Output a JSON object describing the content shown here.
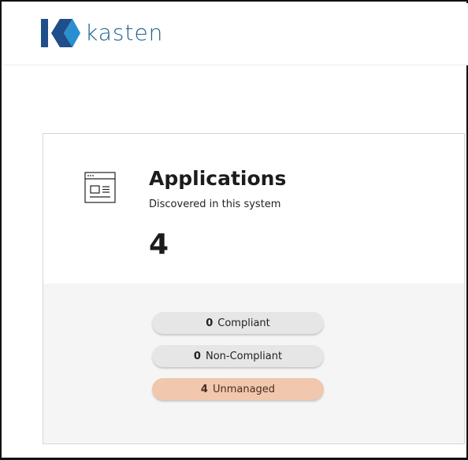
{
  "brand": {
    "name": "kasten"
  },
  "card": {
    "title": "Applications",
    "subtitle": "Discovered in this system",
    "count": "4",
    "icon": "application-window-icon"
  },
  "statuses": [
    {
      "count": "0",
      "label": "Compliant",
      "color": "#e6e6e6"
    },
    {
      "count": "0",
      "label": "Non-Compliant",
      "color": "#e6e6e6"
    },
    {
      "count": "4",
      "label": "Unmanaged",
      "color": "#f1c8ae"
    }
  ],
  "colors": {
    "brand_blue": "#1f5f8f",
    "logo_dark": "#1f4e8a",
    "logo_light": "#2a8fd0",
    "unmanaged": "#f1c8ae"
  }
}
